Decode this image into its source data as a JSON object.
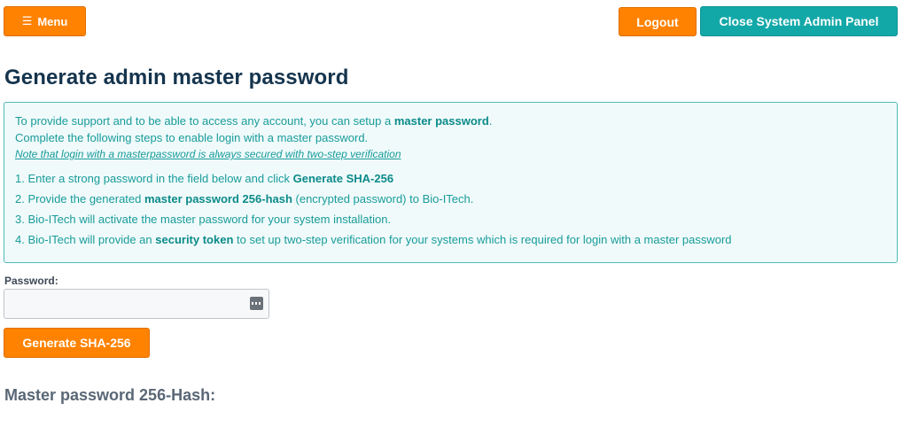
{
  "header": {
    "menu_label": "Menu",
    "logout_label": "Logout",
    "close_label": "Close System Admin Panel"
  },
  "page_title": "Generate admin master password",
  "info": {
    "line1_pre": "To provide support and to be able to access any account, you can setup a ",
    "line1_bold": "master password",
    "line1_post": ".",
    "line2": "Complete the following steps to enable login with a master password.",
    "note": "Note that login with a masterpassword is always secured with two-step verification",
    "steps": [
      {
        "pre": "1. Enter a strong password in the field below and click ",
        "bold": "Generate SHA-256",
        "post": ""
      },
      {
        "pre": "2. Provide the generated ",
        "bold": "master password 256-hash",
        "post": " (encrypted password) to Bio-ITech."
      },
      {
        "pre": "3. Bio-ITech will activate the master password for your system installation.",
        "bold": "",
        "post": ""
      },
      {
        "pre": "4. Bio-ITech will provide an ",
        "bold": "security token",
        "post": " to set up two-step verification for your systems which is required for login with a master password"
      }
    ]
  },
  "form": {
    "password_label": "Password:",
    "password_value": "",
    "generate_label": "Generate SHA-256"
  },
  "result_label": "Master password 256-Hash:"
}
